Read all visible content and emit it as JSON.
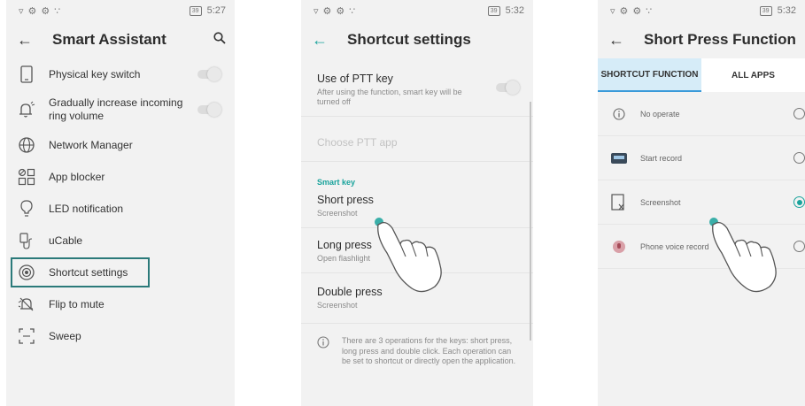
{
  "panel1": {
    "status": {
      "time": "5:27",
      "battery": "39"
    },
    "title": "Smart Assistant",
    "items": [
      {
        "label": "Physical key switch",
        "icon": "phone-outline-icon",
        "toggle": false
      },
      {
        "label": "Gradually increase incoming ring volume",
        "icon": "bell-volume-icon",
        "toggle": false
      },
      {
        "label": "Network Manager",
        "icon": "globe-icon"
      },
      {
        "label": "App blocker",
        "icon": "app-grid-block-icon"
      },
      {
        "label": "LED notification",
        "icon": "bulb-icon"
      },
      {
        "label": "uCable",
        "icon": "cable-icon"
      },
      {
        "label": "Shortcut settings",
        "icon": "target-icon",
        "highlighted": true
      },
      {
        "label": "Flip to mute",
        "icon": "bell-off-icon"
      },
      {
        "label": "Sweep",
        "icon": "scan-frame-icon"
      }
    ]
  },
  "panel2": {
    "status": {
      "time": "5:32",
      "battery": "39"
    },
    "title": "Shortcut settings",
    "ptt": {
      "title": "Use of PTT key",
      "subtitle": "After using the function, smart key will be turned off",
      "toggle": false
    },
    "choose_ptt": "Choose PTT app",
    "section": "Smart key",
    "short_press": {
      "title": "Short press",
      "value": "Screenshot"
    },
    "long_press": {
      "title": "Long press",
      "value": "Open flashlight"
    },
    "double_press": {
      "title": "Double press",
      "value": "Screenshot"
    },
    "info": "There are 3 operations for the keys: short press, long press and double click. Each operation can be set to shortcut or directly open the application."
  },
  "panel3": {
    "status": {
      "battery": "39",
      "time": "5:32"
    },
    "title": "Short Press Function",
    "tabs": [
      "SHORTCUT FUNCTION",
      "ALL APPS"
    ],
    "active_tab": 0,
    "options": [
      {
        "label": "No operate",
        "icon": "info-icon",
        "selected": false
      },
      {
        "label": "Start record",
        "icon": "recorder-icon",
        "selected": false
      },
      {
        "label": "Screenshot",
        "icon": "screenshot-icon",
        "selected": true
      },
      {
        "label": "Phone voice record",
        "icon": "voice-record-icon",
        "selected": false
      }
    ]
  },
  "colors": {
    "accent": "#1aa39c",
    "tab_active": "#d6ecf8",
    "highlight_border": "#2b7a7a"
  }
}
